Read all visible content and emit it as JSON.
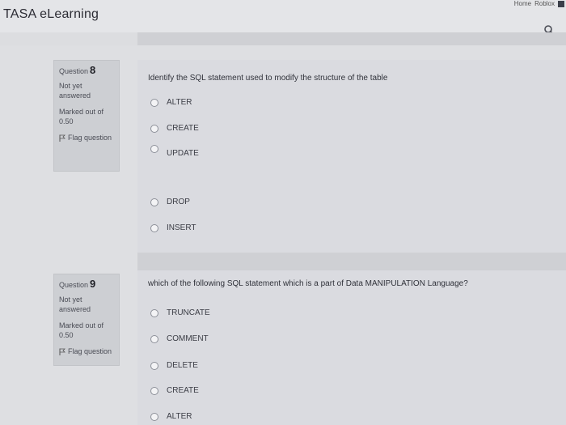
{
  "header": {
    "brand": "TASA eLearning",
    "links": [
      "Home",
      "Roblox"
    ],
    "search_icon": "search-icon"
  },
  "questions": [
    {
      "label": "Question",
      "number": "8",
      "state": "Not yet answered",
      "state_line1": "Not yet",
      "state_line2": "answered",
      "marks_line1": "Marked out of",
      "marks_line2": "0.50",
      "flag": "Flag question",
      "text": "Identify the SQL statement used to modify the structure of the table",
      "options": [
        "ALTER",
        "CREATE",
        "UPDATE",
        "DROP",
        "INSERT"
      ]
    },
    {
      "label": "Question",
      "number": "9",
      "state_line1": "Not yet",
      "state_line2": "answered",
      "marks_line1": "Marked out of",
      "marks_line2": "0.50",
      "flag": "Flag question",
      "text": "which of the following SQL statement which is a part of Data MANIPULATION Language?",
      "options": [
        "TRUNCATE",
        "COMMENT",
        "DELETE",
        "CREATE",
        "ALTER"
      ]
    }
  ]
}
